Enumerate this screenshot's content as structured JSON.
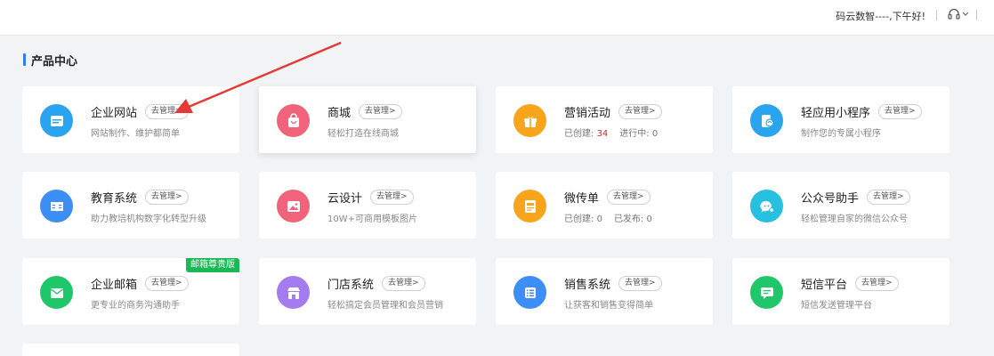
{
  "header": {
    "greeting": "码云数智----,下午好!",
    "support_icon": "headset-icon",
    "dropdown_icon": "chevron-down-icon"
  },
  "section": {
    "title": "产品中心"
  },
  "manage_label": "去管理>",
  "colors": {
    "accent": "#2f7cf6",
    "annotation_arrow": "#e53935",
    "tag": "#19b955",
    "count_highlight": "#d9262b"
  },
  "products": [
    {
      "name": "企业网站",
      "desc": "网站制作、维护都简单",
      "icon": "browser-window-icon",
      "color": "#2ba4f0"
    },
    {
      "name": "商城",
      "desc": "轻松打造在线商城",
      "icon": "shopping-bag-icon",
      "color": "#f0637a"
    },
    {
      "name": "营销活动",
      "icon": "gift-icon",
      "color": "#f8a41c",
      "stats": [
        {
          "label": "已创建:",
          "value": "34"
        },
        {
          "label": "进行中:",
          "value": "0"
        }
      ]
    },
    {
      "name": "轻应用小程序",
      "desc": "制作您的专属小程序",
      "icon": "mini-program-icon",
      "color": "#2ba4f0"
    },
    {
      "name": "教育系统",
      "desc": "助力教培机构数字化转型升级",
      "icon": "book-icon",
      "color": "#3d8ef5"
    },
    {
      "name": "云设计",
      "desc": "10W+可商用模板图片",
      "icon": "image-icon",
      "color": "#f0637a"
    },
    {
      "name": "微传单",
      "icon": "flyer-icon",
      "color": "#f8a41c",
      "stats": [
        {
          "label": "已创建:",
          "value": "0"
        },
        {
          "label": "已发布:",
          "value": "0"
        }
      ]
    },
    {
      "name": "公众号助手",
      "desc": "轻松管理自家的微信公众号",
      "icon": "chat-settings-icon",
      "color": "#27c0e0"
    },
    {
      "name": "企业邮箱",
      "desc": "更专业的商务沟通助手",
      "icon": "mail-icon",
      "color": "#1fc76a",
      "tag": "邮箱尊贵版"
    },
    {
      "name": "门店系统",
      "desc": "轻松搞定会员管理和会员营销",
      "icon": "store-icon",
      "color": "#a57cf0"
    },
    {
      "name": "销售系统",
      "desc": "让获客和销售变得简单",
      "icon": "list-icon",
      "color": "#3d8ef5"
    },
    {
      "name": "短信平台",
      "desc": "短信发送管理平台",
      "icon": "message-icon",
      "color": "#1fc76a"
    }
  ]
}
